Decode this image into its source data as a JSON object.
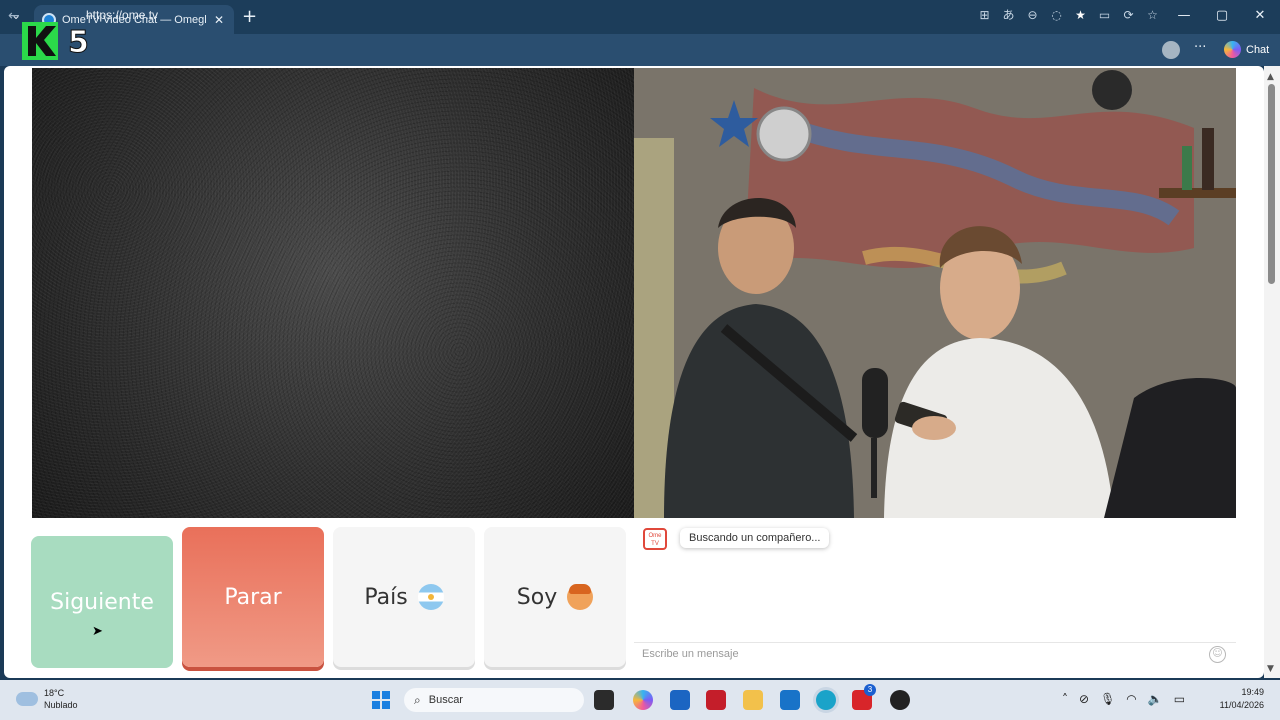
{
  "browser": {
    "tab_title": "OmeTV Video Chat — Omegl",
    "url": "https://ome.tv",
    "copilot_label": "Chat",
    "window_controls": [
      "—",
      "▢",
      "✕"
    ]
  },
  "overlay": {
    "channel_logo": "K5"
  },
  "controls": {
    "next_label": "Siguiente",
    "stop_label": "Parar",
    "country_label": "País",
    "gender_label": "Soy"
  },
  "chat": {
    "logo_text": "Ome TV",
    "status_message": "Buscando un compañero...",
    "input_placeholder": "Escribe un mensaje"
  },
  "taskbar": {
    "temperature": "18°C",
    "weather": "Nublado",
    "search_label": "Buscar",
    "time": "19:49",
    "date": "11/04/2026",
    "badge_count": "3"
  },
  "colors": {
    "next_button": "#a8dcc0",
    "stop_button": "#e9705a",
    "browser_chrome": "#1c3d5a"
  }
}
